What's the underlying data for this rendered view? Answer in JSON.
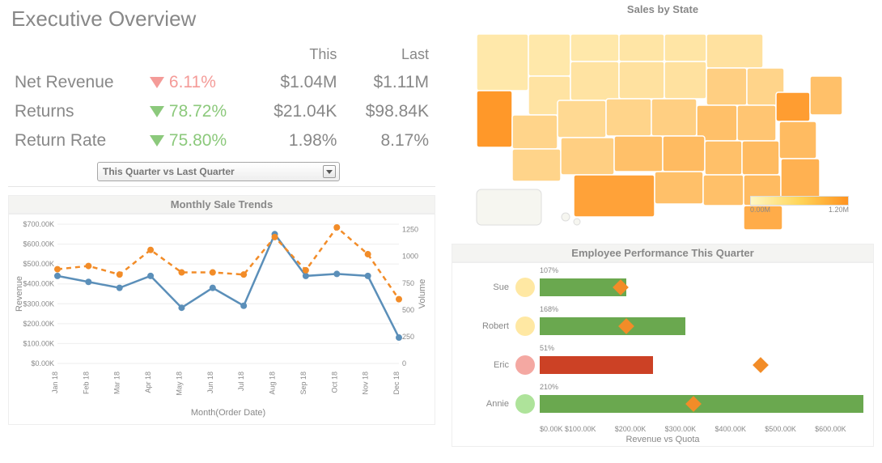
{
  "title": "Executive Overview",
  "headers": {
    "this": "This",
    "last": "Last"
  },
  "metrics": [
    {
      "label": "Net Revenue",
      "dir": "down",
      "delta": "6.11%",
      "this": "$1.04M",
      "last": "$1.11M"
    },
    {
      "label": "Returns",
      "dir": "down",
      "delta": "78.72%",
      "this": "$21.04K",
      "last": "$98.84K",
      "good": true
    },
    {
      "label": "Return Rate",
      "dir": "down",
      "delta": "75.80%",
      "this": "1.98%",
      "last": "8.17%",
      "good": true
    }
  ],
  "dropdown": {
    "selected": "This Quarter vs Last Quarter"
  },
  "monthly": {
    "title": "Monthly Sale Trends",
    "xlabel": "Month(Order Date)",
    "ylabel_left": "Revenue",
    "ylabel_right": "Volume"
  },
  "map": {
    "title": "Sales by State",
    "legend_min": "0.00M",
    "legend_max": "1.20M"
  },
  "employee": {
    "title": "Employee Performance This Quarter",
    "xlabel": "Revenue vs Quota"
  },
  "chart_data": [
    {
      "name": "monthly_sales",
      "type": "line",
      "title": "Monthly Sale Trends",
      "xlabel": "Month(Order Date)",
      "ylabel": "Revenue",
      "y2label": "Volume",
      "categories": [
        "Jan 18",
        "Feb 18",
        "Mar 18",
        "Apr 18",
        "May 18",
        "Jun 18",
        "Jul 18",
        "Aug 18",
        "Sep 18",
        "Oct 18",
        "Nov 18",
        "Dec 18"
      ],
      "series": [
        {
          "name": "Revenue",
          "axis": "left",
          "style": "solid",
          "color": "#5b8fb9",
          "values": [
            440000,
            410000,
            380000,
            440000,
            280000,
            380000,
            290000,
            650000,
            440000,
            450000,
            440000,
            130000
          ]
        },
        {
          "name": "Volume",
          "axis": "right",
          "style": "dashed",
          "color": "#f28c28",
          "values": [
            880,
            910,
            830,
            1060,
            850,
            850,
            830,
            1180,
            870,
            1270,
            1020,
            600
          ]
        }
      ],
      "ylim_left": [
        0,
        700000
      ],
      "yticks_left": [
        "$0.00K",
        "$100.00K",
        "$200.00K",
        "$300.00K",
        "$400.00K",
        "$500.00K",
        "$600.00K",
        "$700.00K"
      ],
      "ylim_right": [
        0,
        1300
      ],
      "yticks_right": [
        0,
        250,
        500,
        750,
        1000,
        1250
      ]
    },
    {
      "name": "sales_by_state",
      "type": "choropleth",
      "title": "Sales by State",
      "legend": {
        "min": 0.0,
        "max": 1.2,
        "unit": "M"
      },
      "note": "US states shaded by sales; CA, TX, PA, NY, FL among highest"
    },
    {
      "name": "employee_performance",
      "type": "bar",
      "title": "Employee Performance This Quarter",
      "xlabel": "Revenue vs Quota",
      "categories": [
        "Sue",
        "Robert",
        "Eric",
        "Annie"
      ],
      "series": [
        {
          "name": "Revenue",
          "values": [
            160000,
            270000,
            210000,
            600000
          ],
          "colors": [
            "#6aa84f",
            "#6aa84f",
            "#cc4125",
            "#6aa84f"
          ]
        },
        {
          "name": "Quota",
          "values": [
            150000,
            160000,
            410000,
            285000
          ],
          "marker": "diamond",
          "color": "#f28c28"
        }
      ],
      "pct_of_quota": [
        "107%",
        "168%",
        "51%",
        "210%"
      ],
      "xlim": [
        0,
        600000
      ],
      "xticks": [
        "$0.00K",
        "$100.00K",
        "$200.00K",
        "$300.00K",
        "$400.00K",
        "$500.00K",
        "$600.00K"
      ]
    }
  ]
}
